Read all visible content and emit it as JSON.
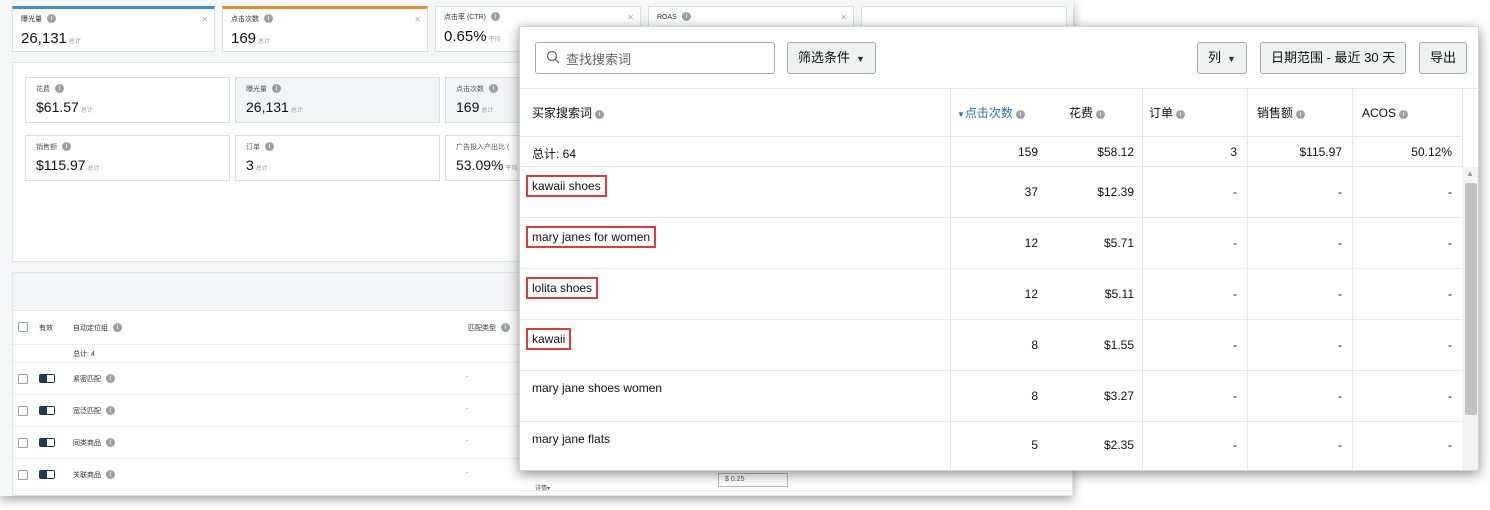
{
  "background": {
    "metric_tabs": [
      {
        "label": "曝光量",
        "value": "26,131",
        "suffix": "总计"
      },
      {
        "label": "点击次数",
        "value": "169",
        "suffix": "总计"
      },
      {
        "label": "点击率 (CTR)",
        "value": "0.65%",
        "suffix": "平均"
      },
      {
        "label": "ROAS",
        "value": "",
        "suffix": ""
      }
    ],
    "kpis": [
      {
        "label": "花费",
        "value": "$61.57",
        "suffix": "总计"
      },
      {
        "label": "曝光量",
        "value": "26,131",
        "suffix": "总计"
      },
      {
        "label": "点击次数",
        "value": "169",
        "suffix": "总计"
      },
      {
        "label": "销售额",
        "value": "$115.97",
        "suffix": "总计"
      },
      {
        "label": "订单",
        "value": "3",
        "suffix": "总计"
      },
      {
        "label": "广告投入产出比 (",
        "value": "53.09%",
        "suffix": "平均"
      }
    ],
    "table": {
      "col_active": "有效",
      "col_target": "自动定位组",
      "col_match": "匹配类型",
      "total": "总计: 4",
      "rows": [
        "紧密匹配",
        "宽泛匹配",
        "同类商品",
        "关联商品"
      ],
      "dash": "-",
      "footer_detail": "详情",
      "footer_bid": "0.25"
    }
  },
  "popup": {
    "search_placeholder": "查找搜索词",
    "filter_label": "筛选条件",
    "columns_label": "列",
    "date_range_label": "日期范围 - 最近 30 天",
    "export_label": "导出",
    "headers": {
      "term": "买家搜索词",
      "clicks": "点击次数",
      "spend": "花费",
      "orders": "订单",
      "sales": "销售额",
      "acos": "ACOS"
    },
    "total": {
      "label": "总计: 64",
      "clicks": "159",
      "spend": "$58.12",
      "orders": "3",
      "sales": "$115.97",
      "acos": "50.12%"
    },
    "rows": [
      {
        "term": "kawaii shoes",
        "clicks": "37",
        "spend": "$12.39",
        "orders": "-",
        "sales": "-",
        "acos": "-",
        "highlighted": true
      },
      {
        "term": "mary janes for women",
        "clicks": "12",
        "spend": "$5.71",
        "orders": "-",
        "sales": "-",
        "acos": "-",
        "highlighted": true
      },
      {
        "term": "lolita shoes",
        "clicks": "12",
        "spend": "$5.11",
        "orders": "-",
        "sales": "-",
        "acos": "-",
        "highlighted": true
      },
      {
        "term": "kawaii",
        "clicks": "8",
        "spend": "$1.55",
        "orders": "-",
        "sales": "-",
        "acos": "-",
        "highlighted": true
      },
      {
        "term": "mary jane shoes women",
        "clicks": "8",
        "spend": "$3.27",
        "orders": "-",
        "sales": "-",
        "acos": "-",
        "highlighted": false
      },
      {
        "term": "mary jane flats",
        "clicks": "5",
        "spend": "$2.35",
        "orders": "-",
        "sales": "-",
        "acos": "-",
        "highlighted": false
      }
    ],
    "colors": {
      "highlight_border": "#e53935",
      "sort_accent": "#2f6fb0"
    }
  }
}
